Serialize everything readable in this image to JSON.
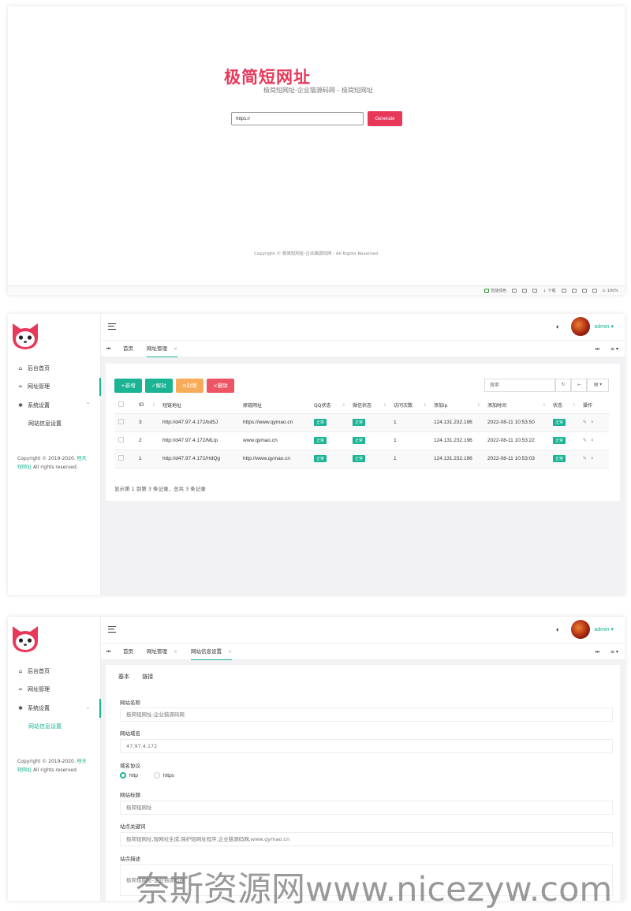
{
  "landing": {
    "title": "极简短网址",
    "subtitle": "极简短网址-企业猫源码网 - 极简短网址",
    "input_value": "https://",
    "generate_label": "Generate",
    "copyright": "Copyright © 极简短网址-企业猫源码网 - All Rights Reserved",
    "statusbar": {
      "items": [
        "智能绿色",
        "下载",
        "100%"
      ]
    }
  },
  "admin": {
    "brand_color": "#1ab394",
    "user": "admin",
    "nav": {
      "home": "后台首页",
      "url_manage": "网址管理",
      "settings": "系统设置",
      "site_settings": "网站信息设置"
    },
    "copyright_prefix": "Copyright © 2019-2020.",
    "copyright_link_a": "極天",
    "copyright_link_b": "短网址",
    "copyright_suffix": "All rights reserved."
  },
  "list_page": {
    "tabs": [
      "首页",
      "网址管理"
    ],
    "buttons": {
      "add": "+新增",
      "unban": "✓解封",
      "ban": "⊘封禁",
      "delete": "×删除"
    },
    "search_placeholder": "搜索",
    "columns": [
      "ID",
      "短链地址",
      "原链网址",
      "QQ状态",
      "微信状态",
      "访问次数",
      "添加ip",
      "添加时间",
      "状态",
      "操作"
    ],
    "rows": [
      {
        "id": "3",
        "short": "http://d47.97.4.172/bd5J",
        "origin": "https://www.qymao.cn",
        "qq": "正常",
        "wx": "正常",
        "visits": "1",
        "ip": "124.131.232.196",
        "time": "2022-08-11 10:53:50",
        "status": "正常"
      },
      {
        "id": "2",
        "short": "http://d47.97.4.172/MLlp",
        "origin": "www.qymao.cn",
        "qq": "正常",
        "wx": "正常",
        "visits": "1",
        "ip": "124.131.232.196",
        "time": "2022-08-11 10:53:22",
        "status": "正常"
      },
      {
        "id": "1",
        "short": "http://d47.97.4.172/HdQg",
        "origin": "http://www.qymao.cn",
        "qq": "正常",
        "wx": "正常",
        "visits": "1",
        "ip": "124.131.232.196",
        "time": "2022-08-11 10:53:03",
        "status": "正常"
      }
    ],
    "page_info": "显示第 1 到第 3 条记录，总共 3 条记录"
  },
  "settings_page": {
    "tabs": [
      "首页",
      "网址管理",
      "网站信息设置"
    ],
    "form_tabs": [
      "基本",
      "链接"
    ],
    "fields": {
      "site_name_label": "网站名称",
      "site_name_value": "极简短网址-企业猫源码网",
      "domain_label": "网站域名",
      "domain_value": "47.97.4.172",
      "protocol_label": "域名协议",
      "protocol_http": "http",
      "protocol_https": "https",
      "site_title_label": "网站标题",
      "site_title_value": "极简短网址",
      "keywords_label": "站点关键词",
      "keywords_value": "极简短网址,短网址生成,保护短网址程序,企业猫源码网,www.qymao.cn",
      "desc_label": "站点描述",
      "desc_value": "极简短网址-企业猫源码网"
    }
  },
  "watermark": "奈斯资源网www.nicezyw.com"
}
